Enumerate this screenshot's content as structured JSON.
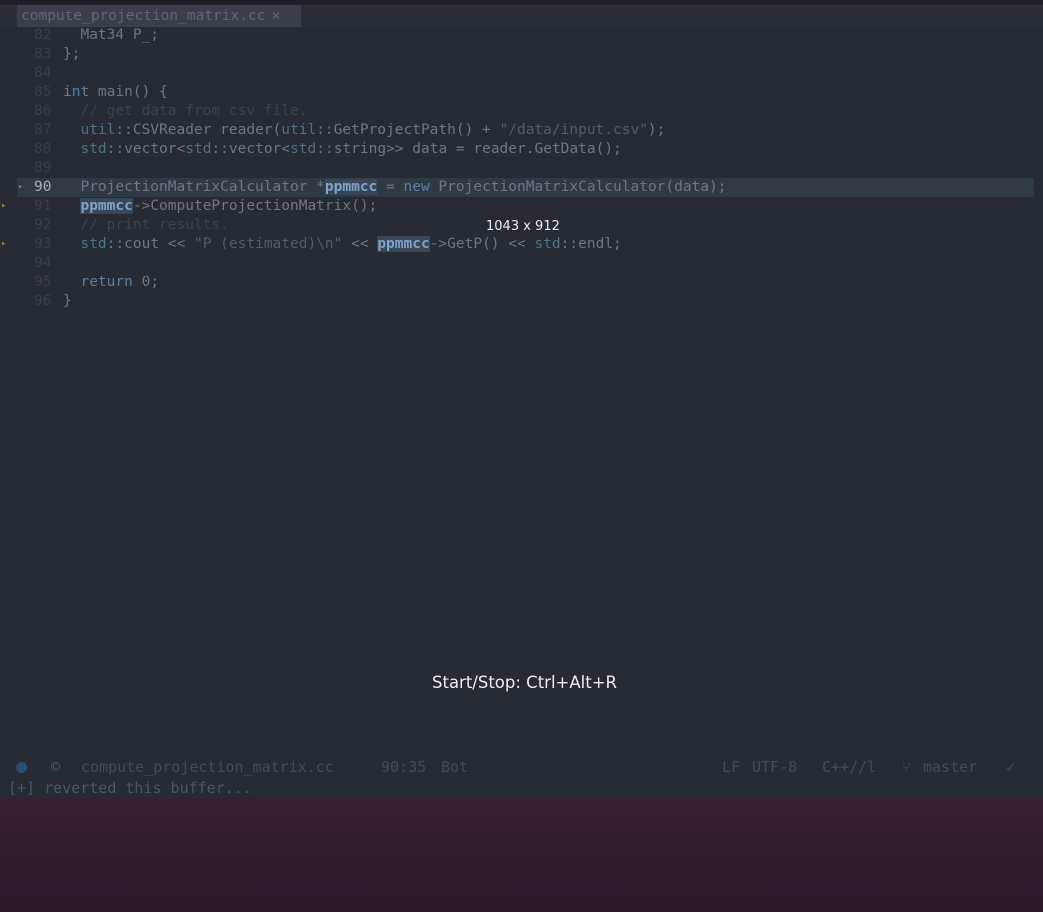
{
  "tab": {
    "filename": "compute_projection_matrix.cc",
    "close": "×"
  },
  "editor": {
    "lines": [
      {
        "num": "82",
        "code": "  Mat34 P_;"
      },
      {
        "num": "83",
        "code": "};"
      },
      {
        "num": "84",
        "code": ""
      },
      {
        "num": "85",
        "code": "int main() {"
      },
      {
        "num": "86",
        "code": "  // get data from csv file."
      },
      {
        "num": "87",
        "code": "  util::CSVReader reader(util::GetProjectPath() + \"/data/input.csv\");"
      },
      {
        "num": "88",
        "code": "  std::vector<std::vector<std::string>> data = reader.GetData();"
      },
      {
        "num": "89",
        "code": ""
      },
      {
        "num": "90",
        "code": "  ProjectionMatrixCalculator *ppmmcc = new ProjectionMatrixCalculator(data);"
      },
      {
        "num": "91",
        "code": "  ppmmcc->ComputeProjectionMatrix();"
      },
      {
        "num": "92",
        "code": "  // print results."
      },
      {
        "num": "93",
        "code": "  std::cout << \"P (estimated)\\n\" << ppmmcc->GetP() << std::endl;"
      },
      {
        "num": "94",
        "code": ""
      },
      {
        "num": "95",
        "code": "  return 0;"
      },
      {
        "num": "96",
        "code": "}"
      }
    ],
    "current_line": "90",
    "marked_lines": [
      "90",
      "91",
      "93"
    ]
  },
  "overlay": {
    "size": "1043 x 912",
    "hint": "Start/Stop: Ctrl+Alt+R"
  },
  "statusbar": {
    "icon": "c-language-icon",
    "filename": "compute_projection_matrix.cc",
    "position": "90:35",
    "scroll": "Bot",
    "eol": "LF",
    "encoding": "UTF-8",
    "mode": "C++//l",
    "branch": "master",
    "check": "✓"
  },
  "minibuffer": "[+] reverted this buffer..."
}
